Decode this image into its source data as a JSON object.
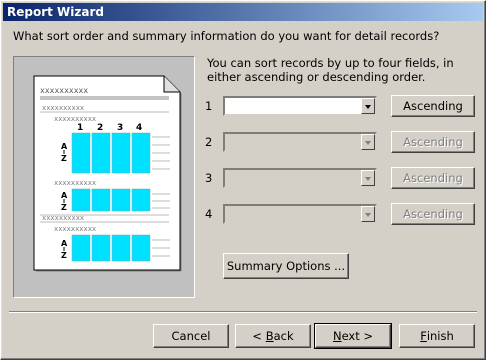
{
  "window": {
    "title": "Report Wizard"
  },
  "question": "What sort order and summary information do you want for detail records?",
  "description": "You can sort records by up to four fields, in either ascending or descending order.",
  "sort_rows": [
    {
      "number": "1",
      "field": "",
      "order": "Ascending",
      "enabled": true
    },
    {
      "number": "2",
      "field": "",
      "order": "Ascending",
      "enabled": false
    },
    {
      "number": "3",
      "field": "",
      "order": "Ascending",
      "enabled": false
    },
    {
      "number": "4",
      "field": "",
      "order": "Ascending",
      "enabled": false
    }
  ],
  "summary_button": "Summary Options ...",
  "preview": {
    "placeholder": "xxxxxxxxxx",
    "column_numbers": [
      "1",
      "2",
      "3",
      "4"
    ],
    "sort_glyph_top": "A",
    "sort_glyph_bottom": "Z"
  },
  "footer": {
    "cancel": "Cancel",
    "back_mnemonic": "B",
    "back_rest": "ack",
    "back_prefix": "< ",
    "next_mnemonic": "N",
    "next_rest": "ext >",
    "finish_mnemonic": "F",
    "finish_rest": "inish"
  },
  "colors": {
    "title_start": "#0a246a",
    "title_end": "#a6caf0",
    "preview_cells": "#00e0ff"
  }
}
